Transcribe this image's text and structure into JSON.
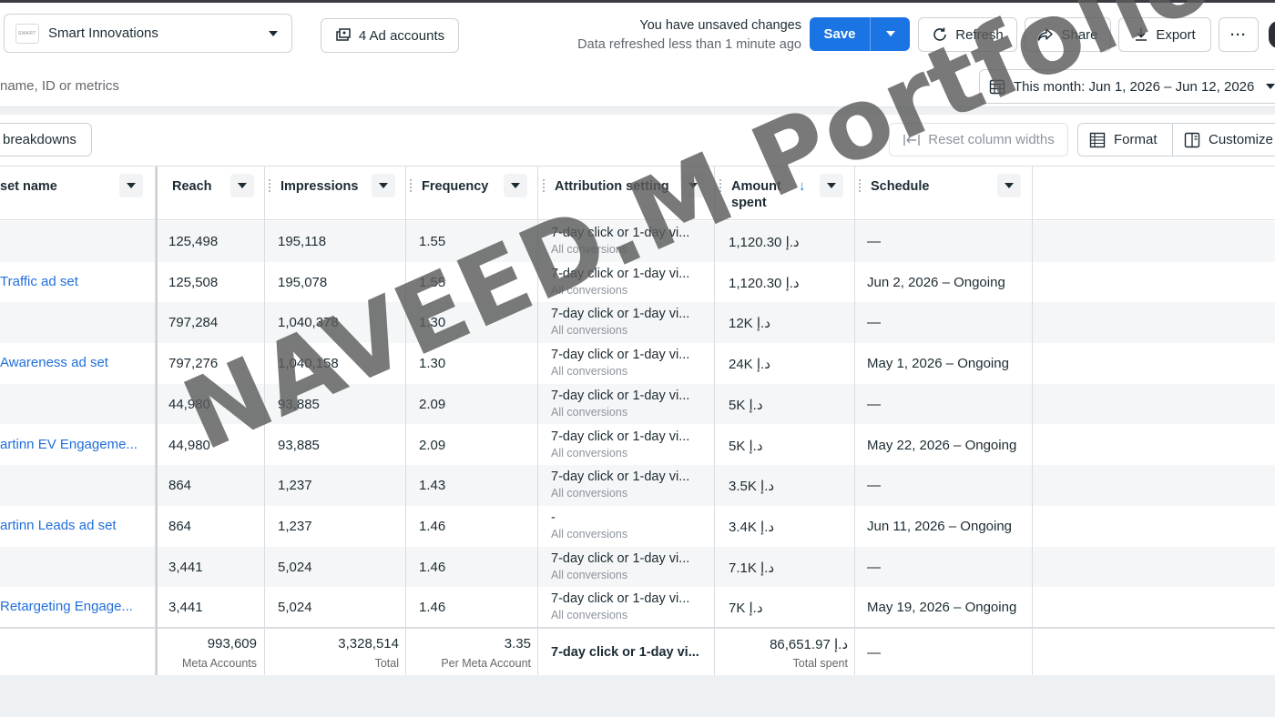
{
  "topbar": {
    "account_name": "Smart Innovations",
    "account_logo_text": "SMART",
    "ad_accounts_label": "4 Ad accounts",
    "unsaved_line1": "You have unsaved changes",
    "unsaved_line2": "Data refreshed less than 1 minute ago",
    "save_label": "Save",
    "refresh_label": "Refresh",
    "share_label": "Share",
    "export_label": "Export",
    "more_label": "···"
  },
  "search": {
    "placeholder": "name, ID or metrics",
    "date_range": "This month: Jun 1, 2026 – Jun 12, 2026"
  },
  "toolbar": {
    "breakdowns_label": "breakdowns",
    "reset_col_label": "Reset column widths",
    "format_label": "Format",
    "customize_label": "Customize"
  },
  "table": {
    "headers": {
      "name": "set name",
      "reach": "Reach",
      "impressions": "Impressions",
      "frequency": "Frequency",
      "attribution": "Attribution setting",
      "amount_l1": "Amount",
      "amount_l2": "spent",
      "schedule": "Schedule"
    },
    "rows": [
      {
        "name": "",
        "reach": "125,498",
        "impressions": "195,118",
        "frequency": "1.55",
        "attr1": "7-day click or 1-day vi...",
        "attr2": "All conversions",
        "amount": "1,120.30 د.إ",
        "schedule": "—"
      },
      {
        "name": "Traffic ad set",
        "reach": "125,508",
        "impressions": "195,078",
        "frequency": "1.55",
        "attr1": "7-day click or 1-day vi...",
        "attr2": "All conversions",
        "amount": "1,120.30 د.إ",
        "schedule": "Jun 2, 2026 – Ongoing"
      },
      {
        "name": "",
        "reach": "797,284",
        "impressions": "1,040,378",
        "frequency": "1.30",
        "attr1": "7-day click or 1-day vi...",
        "attr2": "All conversions",
        "amount": "12K د.إ",
        "schedule": "—"
      },
      {
        "name": "Awareness ad set",
        "reach": "797,276",
        "impressions": "1,040,158",
        "frequency": "1.30",
        "attr1": "7-day click or 1-day vi...",
        "attr2": "All conversions",
        "amount": "24K د.إ",
        "schedule": "May 1, 2026 – Ongoing"
      },
      {
        "name": "",
        "reach": "44,980",
        "impressions": "93,885",
        "frequency": "2.09",
        "attr1": "7-day click or 1-day vi...",
        "attr2": "All conversions",
        "amount": "5K د.إ",
        "schedule": "—"
      },
      {
        "name": "artinn EV Engageme...",
        "reach": "44,980",
        "impressions": "93,885",
        "frequency": "2.09",
        "attr1": "7-day click or 1-day vi...",
        "attr2": "All conversions",
        "amount": "5K د.إ",
        "schedule": "May 22, 2026 – Ongoing"
      },
      {
        "name": "",
        "reach": "864",
        "impressions": "1,237",
        "frequency": "1.43",
        "attr1": "7-day click or 1-day vi...",
        "attr2": "All conversions",
        "amount": "3.5K د.إ",
        "schedule": "—"
      },
      {
        "name": "artinn Leads ad set",
        "reach": "864",
        "impressions": "1,237",
        "frequency": "1.46",
        "attr1": "-",
        "attr2": "All conversions",
        "amount": "3.4K د.إ",
        "schedule": "Jun 11, 2026 – Ongoing"
      },
      {
        "name": "",
        "reach": "3,441",
        "impressions": "5,024",
        "frequency": "1.46",
        "attr1": "7-day click or 1-day vi...",
        "attr2": "All conversions",
        "amount": "7.1K د.إ",
        "schedule": "—"
      },
      {
        "name": "Retargeting Engage...",
        "reach": "3,441",
        "impressions": "5,024",
        "frequency": "1.46",
        "attr1": "7-day click or 1-day vi...",
        "attr2": "All conversions",
        "amount": "7K د.إ",
        "schedule": "May 19, 2026 – Ongoing"
      }
    ],
    "totals": {
      "reach": "993,609",
      "reach_sub": "Meta Accounts",
      "impressions": "3,328,514",
      "impressions_sub": "Total",
      "frequency": "3.35",
      "frequency_sub": "Per Meta Account",
      "attribution": "7-day click or 1-day vi...",
      "amount": "86,651.97 د.إ",
      "amount_sub": "Total spent",
      "schedule": "—"
    }
  },
  "watermark": "NAVEED.M Portfolio"
}
